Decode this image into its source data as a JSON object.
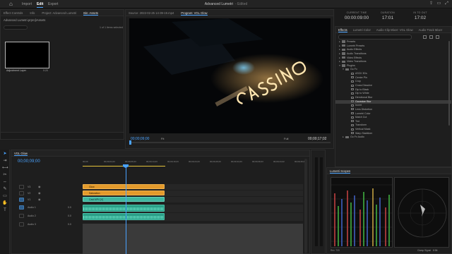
{
  "topbar": {
    "nav": [
      "Import",
      "Edit",
      "Export"
    ],
    "active": "Edit",
    "project_title": "Advanced Lumetri",
    "project_status": "- Edited"
  },
  "project_panel": {
    "tabs": [
      "Effect Controls",
      "Info",
      "Project: Advanced Lumetri",
      "Bin: Assets"
    ],
    "active_tab": "Bin: Assets",
    "path": "Advanced Lumetri.prproj\\Assets",
    "count": "1 of 1 items selected",
    "item": {
      "name": "Adjustment Layer",
      "duration": "0:20"
    }
  },
  "program_monitor": {
    "tabs": [
      "Source: 2022-02-25 14-39-19.mp4",
      "Program: VGL Glow"
    ],
    "active_tab": "Program: VGL Glow",
    "timecode": "00;00;09;00",
    "fit": "Fit",
    "resolution": "Full",
    "duration": "00;00;17;02",
    "controls": [
      "{",
      "|←",
      "{←",
      "◀|",
      "▶",
      "|▶",
      "→}",
      "⇱",
      "⇲",
      "▣",
      "+"
    ]
  },
  "timecode_header": {
    "current_time_label": "CURRENT TIME",
    "current_time": "00:00:09:00",
    "duration_label": "DURATION",
    "duration": "17:01",
    "in_out_label": "IN TO OUT",
    "in_out": "17:02"
  },
  "effects_panel": {
    "tabs": [
      "Effects",
      "Lumetri Color",
      "Audio Clip Mixer: VGL Glow",
      "Audio Track Mixer"
    ],
    "active_tab": "Effects",
    "items": [
      {
        "label": "Presets",
        "level": 0,
        "type": "folder"
      },
      {
        "label": "Lumetri Presets",
        "level": 0,
        "type": "folder"
      },
      {
        "label": "Audio Effects",
        "level": 0,
        "type": "folder"
      },
      {
        "label": "Audio Transitions",
        "level": 0,
        "type": "folder"
      },
      {
        "label": "Video Effects",
        "level": 0,
        "type": "folder"
      },
      {
        "label": "Video Transitions",
        "level": 0,
        "type": "folder"
      },
      {
        "label": "Plugins",
        "level": 0,
        "type": "folder",
        "open": true
      },
      {
        "label": "Go Fx",
        "level": 1,
        "type": "folder",
        "open": true
      },
      {
        "label": "ASCII 3Ds",
        "level": 2,
        "type": "fx"
      },
      {
        "label": "Center Pin",
        "level": 2,
        "type": "fx"
      },
      {
        "label": "Crop",
        "level": 2,
        "type": "fx"
      },
      {
        "label": "Cross Dissolve",
        "level": 2,
        "type": "fx"
      },
      {
        "label": "Dip to Black",
        "level": 2,
        "type": "fx"
      },
      {
        "label": "Dip to White",
        "level": 2,
        "type": "fx"
      },
      {
        "label": "Directional Blur",
        "level": 2,
        "type": "fx"
      },
      {
        "label": "Gaussian Blur",
        "level": 2,
        "type": "fx",
        "selected": true
      },
      {
        "label": "Invert",
        "level": 2,
        "type": "fx"
      },
      {
        "label": "Lens Distortion",
        "level": 2,
        "type": "fx"
      },
      {
        "label": "Lumetri Color",
        "level": 2,
        "type": "fx"
      },
      {
        "label": "Match Cut",
        "level": 2,
        "type": "fx"
      },
      {
        "label": "Tint",
        "level": 2,
        "type": "fx"
      },
      {
        "label": "Transform",
        "level": 2,
        "type": "fx"
      },
      {
        "label": "Vertical Mask",
        "level": 2,
        "type": "fx"
      },
      {
        "label": "Warp Stabilizer",
        "level": 2,
        "type": "fx"
      },
      {
        "label": "Go Fx Audio",
        "level": 1,
        "type": "folder"
      }
    ]
  },
  "timeline": {
    "sequence_name": "VGL Glow",
    "timecode": "00;00;09;00",
    "ruler_ticks": [
      "00;00",
      "00;00;04;23",
      "00;00;09;23",
      "00;00;14;23",
      "00;00;19;23",
      "00;00;24;23",
      "00;00;29;23",
      "00;00;34;23",
      "00;00;39;23",
      "00;00;44;22",
      "00;00;49;22"
    ],
    "video_tracks": [
      {
        "id": "V3",
        "clip": "Glow",
        "color": "#e39a2c"
      },
      {
        "id": "V2",
        "clip": "Saturation",
        "color": "#e39a2c"
      },
      {
        "id": "V1",
        "clip": "Cast.MP4 [V]",
        "color": "#40b6a0"
      }
    ],
    "audio_tracks": [
      {
        "id": "A1",
        "name": "Audio 1",
        "level": "0.0"
      },
      {
        "id": "A2",
        "name": "Audio 2",
        "level": "0.0"
      },
      {
        "id": "A3",
        "name": "Audio 3",
        "level": "0.0"
      }
    ]
  },
  "scopes": {
    "title": "Lumetri Scopes",
    "footer_left": "Rec. 709",
    "footer_clamp": "Clamp Signal",
    "footer_bit": "8 Bit"
  }
}
